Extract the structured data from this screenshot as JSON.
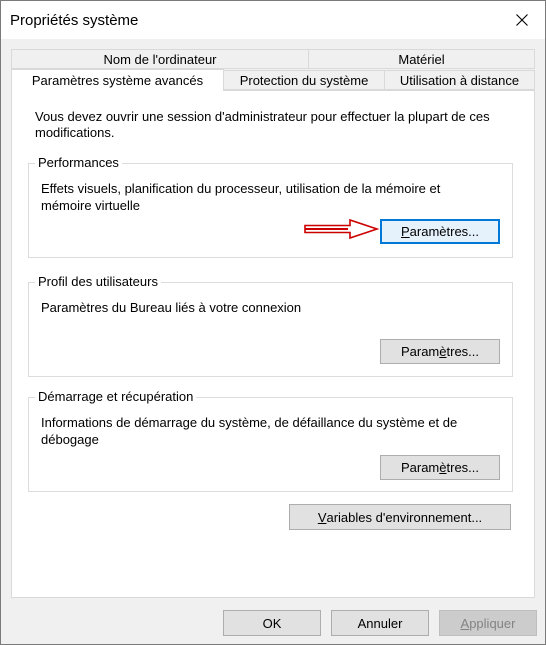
{
  "window": {
    "title": "Propriétés système",
    "close_icon": "close-icon"
  },
  "tabs": {
    "row_back": [
      {
        "label": "Nom de l'ordinateur"
      },
      {
        "label": "Matériel"
      }
    ],
    "row_front": [
      {
        "label": "Paramètres système avancés",
        "active": true
      },
      {
        "label": "Protection du système"
      },
      {
        "label": "Utilisation à distance"
      }
    ]
  },
  "panel": {
    "admin_note": "Vous devez ouvrir une session d'administrateur pour effectuer la plupart de ces modifications.",
    "performances": {
      "legend": "Performances",
      "desc": "Effets visuels, planification du processeur, utilisation de la mémoire et mémoire virtuelle",
      "button": {
        "pre": "",
        "accel": "P",
        "post": "aramètres..."
      }
    },
    "profiles": {
      "legend": "Profil des utilisateurs",
      "desc": "Paramètres du Bureau liés à votre connexion",
      "button": {
        "pre": "Param",
        "accel": "è",
        "post": "tres..."
      }
    },
    "startup": {
      "legend": "Démarrage et récupération",
      "desc": "Informations de démarrage du système, de défaillance du système et de débogage",
      "button": {
        "pre": "Param",
        "accel": "è",
        "post": "tres..."
      }
    },
    "env_button": {
      "pre": "",
      "accel": "V",
      "post": "ariables d'environnement..."
    }
  },
  "footer": {
    "ok": "OK",
    "cancel": "Annuler",
    "apply": {
      "pre": "",
      "accel": "A",
      "post": "ppliquer"
    }
  },
  "annotation": {
    "arrow_color": "#cc0000"
  },
  "colors": {
    "focus_border": "#0078d7",
    "button_bg": "#e1e1e1",
    "window_bg": "#f0f0f0"
  }
}
